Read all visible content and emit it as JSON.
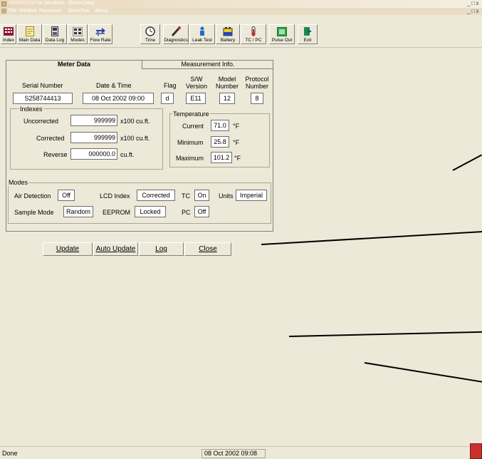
{
  "window": {
    "title": "SONIXCOM for Windows - [Main Data]",
    "controls": [
      "_",
      "□",
      "x"
    ]
  },
  "menu": [
    "File",
    "Window",
    "Password",
    "Send Port",
    "About"
  ],
  "toolbar": [
    "Index",
    "Main Data",
    "Data Log",
    "Modes",
    "Flow Rate",
    "Time",
    "Diagnostics",
    "Leak Test",
    "Battery",
    "TC / PC",
    "Pulse Out",
    "Exit"
  ],
  "tabs": {
    "meter": "Meter Data",
    "measurement": "Measurement Info."
  },
  "meter": {
    "serial_label": "Serial Number",
    "serial": "S258744413",
    "datetime_label": "Date & Time",
    "datetime": "08 Oct 2002  09:00",
    "flag_label": "Flag",
    "flag": "d",
    "sw_label1": "S/W",
    "sw_label2": "Version",
    "sw": "E11",
    "model_label1": "Model",
    "model_label2": "Number",
    "model": "12",
    "protocol_label1": "Protocol",
    "protocol_label2": "Number",
    "protocol": "8"
  },
  "indexes": {
    "title": "Indexes",
    "uncorrected_label": "Uncorrected",
    "uncorrected": "999999",
    "uncorrected_unit": "x100 cu.ft.",
    "corrected_label": "Corrected",
    "corrected": "999999",
    "corrected_unit": "x100 cu.ft.",
    "reverse_label": "Reverse",
    "reverse": "000000.0",
    "reverse_unit": "cu.ft."
  },
  "temperature": {
    "title": "Temperature",
    "current_label": "Current",
    "current": "71.0",
    "minimum_label": "Minimum",
    "minimum": "25.8",
    "maximum_label": "Maximum",
    "maximum": "101.2",
    "unit": "°F"
  },
  "modes": {
    "title": "Modes",
    "air_label": "Air Detection",
    "air": "Off",
    "lcd_label": "LCD Index",
    "lcd": "Corrected",
    "tc_label": "TC",
    "tc": "On",
    "units_label": "Units",
    "units": "Imperial",
    "sample_label": "Sample Mode",
    "sample": "Random",
    "eeprom_label": "EEPROM",
    "eeprom": "Locked",
    "pc_label": "PC",
    "pc": "Off"
  },
  "actions": {
    "update": "Update",
    "auto_update": "Auto Update",
    "log": "Log",
    "close": "Close"
  },
  "status": {
    "text": "Done",
    "datetime": "08 Oct 2002  09:08"
  }
}
